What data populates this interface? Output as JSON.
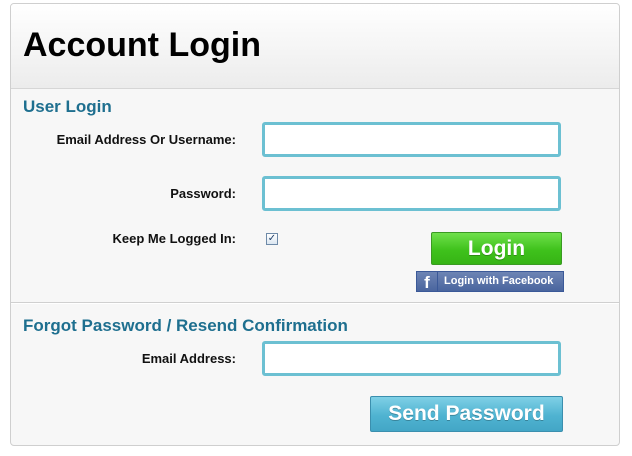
{
  "header": {
    "title": "Account Login"
  },
  "user_login": {
    "section_title": "User Login",
    "email_label": "Email Address Or Username:",
    "email_value": "",
    "password_label": "Password:",
    "password_value": "",
    "keep_logged_in_label": "Keep Me Logged In:",
    "keep_logged_in_checked": true,
    "login_button_label": "Login",
    "facebook_button_label": "Login with Facebook",
    "facebook_icon": "facebook-f-icon"
  },
  "forgot_password": {
    "section_title": "Forgot Password / Resend Confirmation",
    "email_label": "Email Address:",
    "email_value": "",
    "send_button_label": "Send Password"
  },
  "colors": {
    "section_title": "#1e6f8f",
    "input_border": "#6cc0d2",
    "login_button": "#3fc21c",
    "send_button": "#4fb3d1",
    "facebook": "#3b5998"
  }
}
